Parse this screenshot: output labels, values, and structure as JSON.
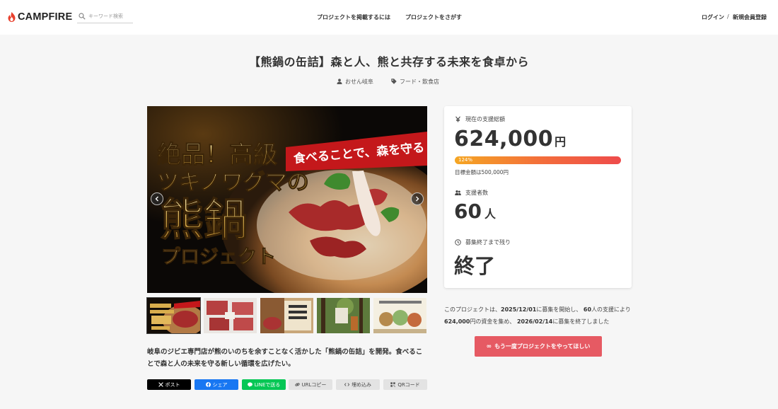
{
  "header": {
    "logo": "CAMPFIRE",
    "search_placeholder": "キーワード検索",
    "nav": {
      "post": "プロジェクトを掲載するには",
      "find": "プロジェクトをさがす"
    },
    "login": "ログイン",
    "separator": "/",
    "register": "新規会員登録"
  },
  "project": {
    "title": "【熊鍋の缶詰】森と人、熊と共存する未来を食卓から",
    "owner": "おせん岐阜",
    "category": "フード・飲食店",
    "hero": {
      "headline_lines": [
        "絶品！高級",
        "ツキノワグマの",
        "熊鍋",
        "プロジェクト"
      ],
      "banner": "食べることで、森を守る"
    },
    "thumbnail_count": 5,
    "description": "岐阜のジビエ専門店が熊のいのちを余すことなく活かした「熊鍋の缶詰」を開発。食べることで森と人の未来を守る新しい循環を広げたい。"
  },
  "share": {
    "post": "ポスト",
    "facebook": "シェア",
    "line": "LINEで送る",
    "url": "URLコピー",
    "embed": "埋め込み",
    "qr": "QRコード"
  },
  "stats": {
    "total_label": "現在の支援総額",
    "total_value": "624,000",
    "currency_unit": "円",
    "progress_percent": 124,
    "progress_text": "124%",
    "goal_text": "目標金額は500,000円",
    "supporters_label": "支援者数",
    "supporters_value": "60",
    "supporters_unit": "人",
    "remaining_label": "募集終了まで残り",
    "remaining_value": "終了"
  },
  "summary": {
    "t1": "このプロジェクトは、",
    "start_date": "2025/12/01",
    "t2": "に募集を開始し、",
    "supporters": "60",
    "t3": "人の支援により",
    "amount": "624,000",
    "t4": "円の資金を集め、",
    "end_date": "2026/02/14",
    "t5": "に募集を終了しました"
  },
  "cta": {
    "icon": "∞",
    "label": "もう一度プロジェクトをやってほしい"
  },
  "colors": {
    "accent": "#e65a63",
    "progress_start": "#f5a623",
    "progress_end": "#ee4b4b",
    "line": "#06c755",
    "facebook": "#1877f2"
  }
}
